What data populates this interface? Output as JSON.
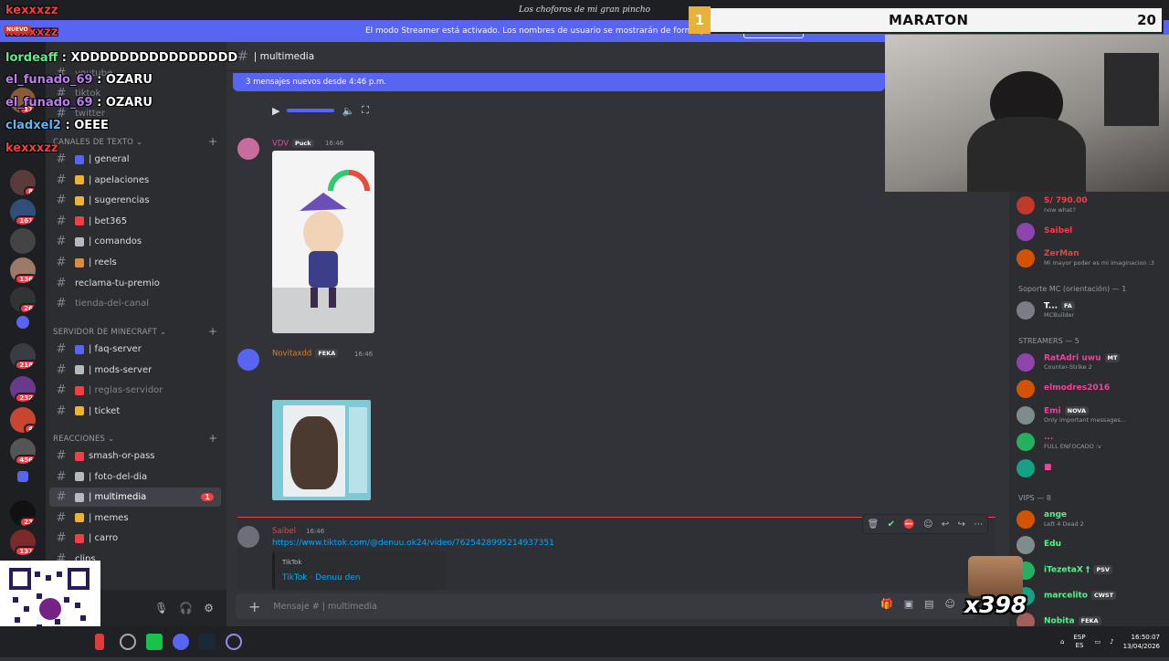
{
  "titlebar": {
    "title": "Los choforos de mi gran pincho"
  },
  "streamer_bar": {
    "text": "El modo Streamer está activado. Los nombres de usuario se mostrarán de forma parcial.",
    "button": "Desactivar"
  },
  "server_badges": [
    "11",
    "8",
    "161",
    "136",
    "26",
    "218",
    "232",
    "4",
    "456",
    "23",
    "131"
  ],
  "categories": {
    "text": "CANALES DE TEXTO",
    "minecraft": "SERVIDOR DE MINECRAFT",
    "reacciones": "REACCIONES"
  },
  "channels_top_faded": [
    "youtube",
    "tiktok",
    "twitter"
  ],
  "channels_text": [
    {
      "label": "| general",
      "color": "#5865f2"
    },
    {
      "label": "| apelaciones",
      "color": "#f0b232"
    },
    {
      "label": "| sugerencias",
      "color": "#f0b232"
    },
    {
      "label": "| bet365",
      "color": "#f23f43"
    },
    {
      "label": "| comandos",
      "color": "#b5bac1"
    },
    {
      "label": "| reels",
      "color": "#d98c3f"
    },
    {
      "label": "reclama-tu-premio",
      "color": ""
    },
    {
      "label": "tienda-del-canal",
      "color": ""
    }
  ],
  "channels_minecraft": [
    {
      "label": "| faq-server",
      "color": "#5865f2"
    },
    {
      "label": "| mods-server",
      "color": "#b5bac1"
    },
    {
      "label": "| reglas-servidor",
      "color": "#f23f43"
    },
    {
      "label": "| ticket",
      "color": "#f0b232"
    }
  ],
  "channels_reacciones": [
    {
      "label": "smash-or-pass",
      "color": "#f23f43"
    },
    {
      "label": "| foto-del-dia",
      "color": "#b5bac1"
    },
    {
      "label": "| multimedia",
      "color": "#b5bac1",
      "badge": "1"
    },
    {
      "label": "| memes",
      "color": "#f0b232"
    },
    {
      "label": "| carro",
      "color": "#f23f43"
    },
    {
      "label": "clips",
      "color": ""
    },
    {
      "label": "edits",
      "color": ""
    }
  ],
  "chat": {
    "channel": "| multimedia",
    "new_messages": "3 mensajes nuevos desde 4:46 p.m.",
    "messages": [
      {
        "author": "VDV",
        "tag": "Puck",
        "time": "16:46",
        "color": "#eb459e"
      },
      {
        "author": "Novitaxdd",
        "tag": "FEKA",
        "time": "16:46",
        "color": "#e67e22"
      },
      {
        "author": "Saibel",
        "tag": "",
        "time": "16:46",
        "color": "#f23f43",
        "link": "https://www.tiktok.com/@denuu.ok24/video/7625428995214937351",
        "embed_provider": "TikTok",
        "embed_title": "TikTok · Denuu den"
      }
    ],
    "composer_placeholder": "Mensaje #  | multimedia"
  },
  "members": {
    "top": [
      {
        "name": "S/ 790.00",
        "sub": "now what?",
        "color": "#f23f43"
      },
      {
        "name": "Saibel",
        "sub": "",
        "color": "#f23f43"
      },
      {
        "name": "ZerMan",
        "sub": "Mi mayor poder es mi imaginacion :3",
        "color": "#f23f43"
      }
    ],
    "group_soporte": "Soporte MC (orientación) — 1",
    "soporte": [
      {
        "name": "T...",
        "tag": "FA",
        "sub": "MCBuilder",
        "color": "#fff"
      }
    ],
    "group_streamers": "STREAMERS — 5",
    "streamers": [
      {
        "name": "RatAdri uwu",
        "tag": "MT",
        "sub": "Counter-Strike 2",
        "color": "#eb459e"
      },
      {
        "name": "elmodres2016",
        "tag": "",
        "sub": "",
        "color": "#eb459e"
      },
      {
        "name": "Emi",
        "tag": "NOVA",
        "sub": "Only important messages...",
        "color": "#eb459e"
      },
      {
        "name": "...",
        "tag": "",
        "sub": "FULL ENFOCADO :v",
        "color": "#eb459e"
      },
      {
        "name": "■",
        "tag": "",
        "sub": "",
        "color": "#eb459e"
      }
    ],
    "group_vips": "VIPS — 8",
    "vips": [
      {
        "name": "ange",
        "tag": "",
        "sub": "Left 4 Dead 2",
        "color": "#57f287"
      },
      {
        "name": "Edu",
        "tag": "",
        "sub": "",
        "color": "#57f287"
      },
      {
        "name": "iTezetaX †",
        "tag": "PSV",
        "sub": "",
        "color": "#57f287"
      },
      {
        "name": "marcelito",
        "tag": "CWST",
        "sub": "",
        "color": "#57f287"
      },
      {
        "name": "Nobita",
        "tag": "FEKA",
        "sub": "",
        "color": "#57f287"
      }
    ]
  },
  "overlay": {
    "rank": "1",
    "maraton": "MARATON",
    "maraton_num": "20",
    "multiplier": "x398",
    "twitch_chat": [
      {
        "user": "kexxxzz",
        "msg": "",
        "color": "#f23f43"
      },
      {
        "user": "kexxxzz",
        "msg": "",
        "color": "#f23f43"
      },
      {
        "user": "lordeaff",
        "msg": "XDDDDDDDDDDDDDDDD",
        "color": "#57f287"
      },
      {
        "user": "el_funado_69",
        "msg": "OZARU",
        "color": "#bd7cf0"
      },
      {
        "user": "el_funado_69",
        "msg": "OZARU",
        "color": "#bd7cf0"
      },
      {
        "user": "cladxel2",
        "msg": "OEEE",
        "color": "#5ab7f5"
      },
      {
        "user": "kexxxzz",
        "msg": "",
        "color": "#f23f43"
      }
    ],
    "nuevo": "NUEVO"
  },
  "taskbar": {
    "lang": "ESP",
    "lang2": "ES",
    "time": "16:50:07",
    "date": "13/04/2026"
  }
}
